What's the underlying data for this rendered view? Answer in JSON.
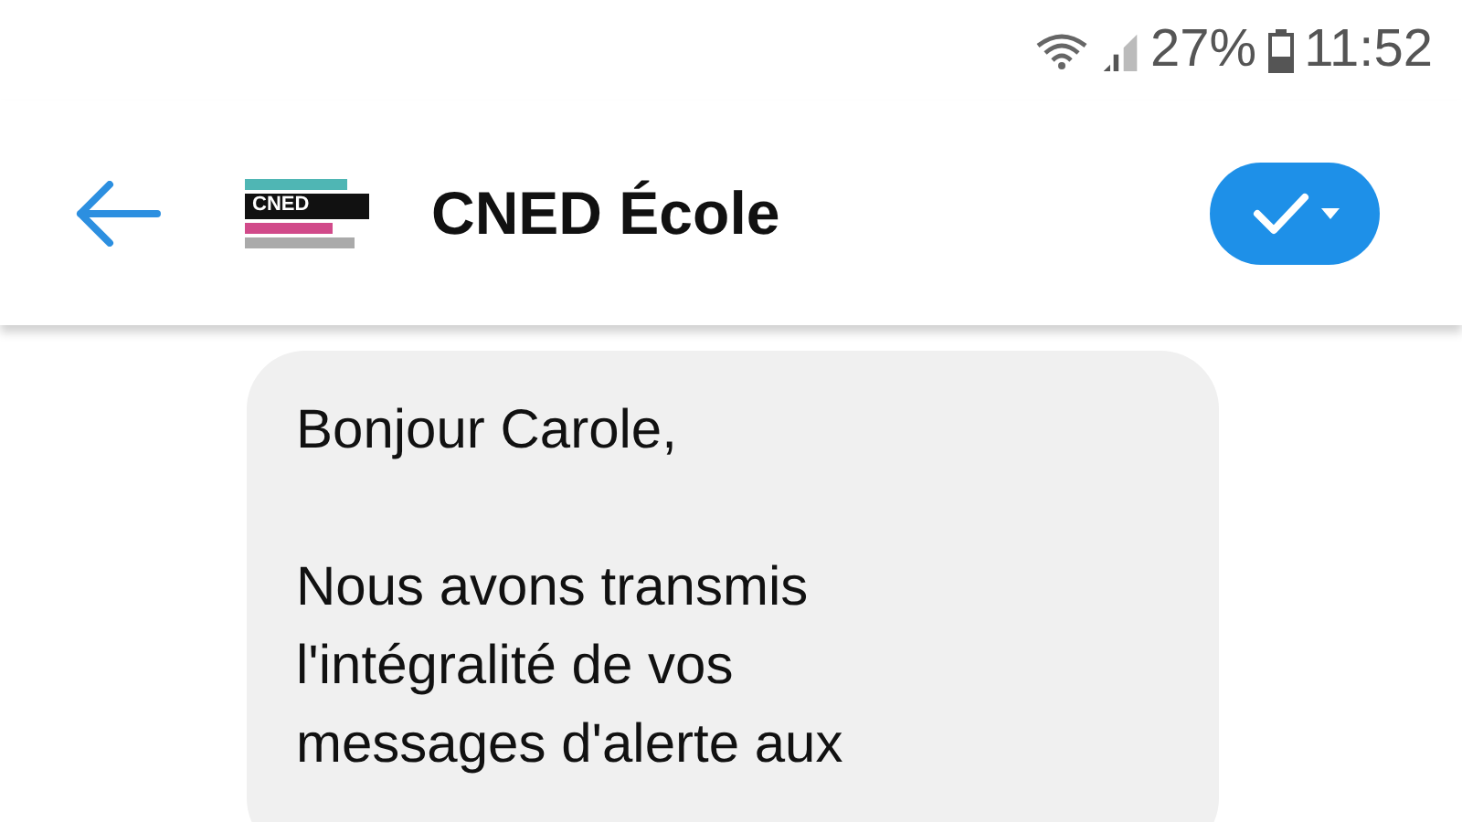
{
  "status_bar": {
    "battery": "27%",
    "time": "11:52"
  },
  "header": {
    "logo_text": "CNED",
    "title": "CNED École"
  },
  "message": {
    "greeting": "Bonjour Carole,",
    "body_lines": [
      "Nous avons transmis",
      "l'intégralité de vos",
      "messages d'alerte aux"
    ]
  }
}
